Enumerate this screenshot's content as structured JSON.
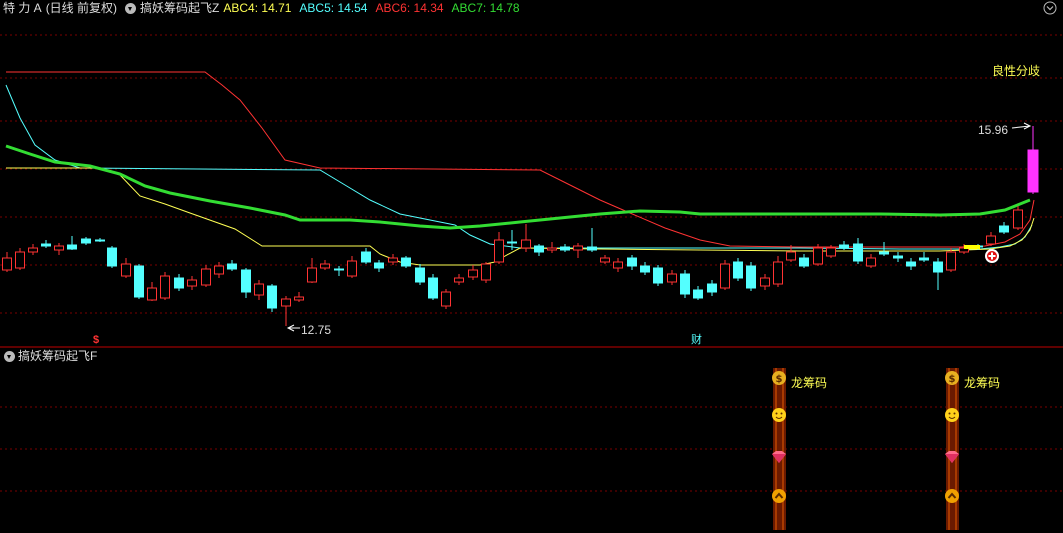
{
  "header": {
    "stock": "特 力 A",
    "period": "(日线 前复权)",
    "indicator_name": "搞妖筹码起飞Z",
    "abc4_label": "ABC4:",
    "abc4_value": "14.71",
    "abc5_label": "ABC5:",
    "abc5_value": "14.54",
    "abc6_label": "ABC6:",
    "abc6_value": "14.34",
    "abc7_label": "ABC7:",
    "abc7_value": "14.78"
  },
  "main": {
    "signal_label": "良性分歧",
    "high_price_label": "15.96",
    "low_price_label": "12.75",
    "marker_dollar": "$",
    "marker_cai": "财"
  },
  "sub": {
    "indicator_name": "搞妖筹码起飞F",
    "column_label_1": "龙筹码",
    "column_label_2": "龙筹码"
  },
  "colors": {
    "up": "#ff3333",
    "down": "#54ffff",
    "abc4": "#ffff54",
    "abc5": "#54ffff",
    "abc6": "#ff3333",
    "abc7": "#33dd33",
    "grid": "#7a0000",
    "magenta": "#ff33ff"
  },
  "icons": [
    "triangle-down-icon",
    "chevron-down-icon",
    "money-bag-icon",
    "smile-icon",
    "gem-icon",
    "up-arrow-icon",
    "plus-circle-icon"
  ]
}
